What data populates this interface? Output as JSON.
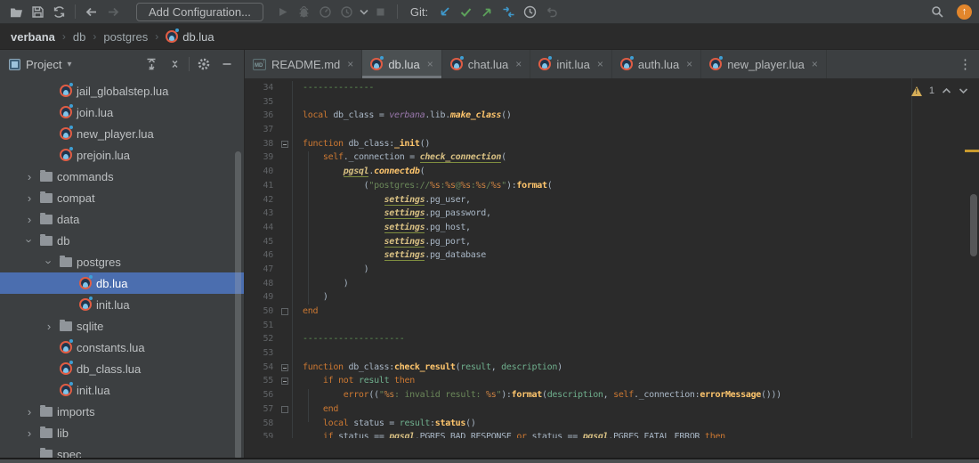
{
  "toolbar": {
    "add_configuration_label": "Add Configuration...",
    "git_label": "Git:",
    "left_icons": [
      "open-project-icon",
      "save-all-icon",
      "synchronize-icon",
      "back-icon",
      "forward-icon"
    ],
    "run_icons": [
      "run-icon",
      "debug-icon",
      "profiler-icon",
      "coverage-icon",
      "dropdown-arrow-icon",
      "stop-icon"
    ],
    "git_icons": [
      "git-update-icon",
      "git-commit-icon",
      "git-push-icon",
      "git-merge-icon",
      "git-history-icon",
      "git-rollback-icon"
    ],
    "right_icons": [
      "search-icon",
      "update-badge"
    ]
  },
  "breadcrumbs": {
    "items": [
      {
        "label": "verbana",
        "bold": true
      },
      {
        "label": "db"
      },
      {
        "label": "postgres"
      },
      {
        "label": "db.lua",
        "icon": "lua"
      }
    ]
  },
  "project_panel": {
    "title": "Project",
    "header_icons": [
      "expand-all-icon",
      "collapse-all-icon",
      "settings-gear-icon",
      "hide-panel-icon"
    ],
    "tree": [
      {
        "label": "jail_globalstep.lua",
        "icon": "lua",
        "level": 2,
        "chevron": "none"
      },
      {
        "label": "join.lua",
        "icon": "lua",
        "level": 2,
        "chevron": "none"
      },
      {
        "label": "new_player.lua",
        "icon": "lua",
        "level": 2,
        "chevron": "none"
      },
      {
        "label": "prejoin.lua",
        "icon": "lua",
        "level": 2,
        "chevron": "none"
      },
      {
        "label": "commands",
        "icon": "folder",
        "level": 1,
        "chevron": "closed"
      },
      {
        "label": "compat",
        "icon": "folder",
        "level": 1,
        "chevron": "closed"
      },
      {
        "label": "data",
        "icon": "folder",
        "level": 1,
        "chevron": "closed"
      },
      {
        "label": "db",
        "icon": "folder",
        "level": 1,
        "chevron": "open"
      },
      {
        "label": "postgres",
        "icon": "folder",
        "level": 2,
        "chevron": "open"
      },
      {
        "label": "db.lua",
        "icon": "lua",
        "level": 3,
        "chevron": "none",
        "selected": true
      },
      {
        "label": "init.lua",
        "icon": "lua",
        "level": 3,
        "chevron": "none"
      },
      {
        "label": "sqlite",
        "icon": "folder",
        "level": 2,
        "chevron": "closed"
      },
      {
        "label": "constants.lua",
        "icon": "lua",
        "level": 2,
        "chevron": "none"
      },
      {
        "label": "db_class.lua",
        "icon": "lua",
        "level": 2,
        "chevron": "none"
      },
      {
        "label": "init.lua",
        "icon": "lua",
        "level": 2,
        "chevron": "none"
      },
      {
        "label": "imports",
        "icon": "folder",
        "level": 1,
        "chevron": "closed"
      },
      {
        "label": "lib",
        "icon": "folder",
        "level": 1,
        "chevron": "closed"
      },
      {
        "label": "spec",
        "icon": "folder",
        "level": 1,
        "chevron": "none"
      }
    ]
  },
  "editor": {
    "tabs": [
      {
        "label": "README.md",
        "icon": "md"
      },
      {
        "label": "db.lua",
        "icon": "lua",
        "active": true
      },
      {
        "label": "chat.lua",
        "icon": "lua"
      },
      {
        "label": "init.lua",
        "icon": "lua"
      },
      {
        "label": "auth.lua",
        "icon": "lua"
      },
      {
        "label": "new_player.lua",
        "icon": "lua"
      }
    ],
    "warning_count": "1",
    "lines": [
      {
        "n": "34",
        "fold": "",
        "segs": [
          [
            "c",
            "--------------"
          ]
        ]
      },
      {
        "n": "35",
        "fold": "",
        "segs": []
      },
      {
        "n": "36",
        "fold": "",
        "segs": [
          [
            "k",
            "local"
          ],
          [
            "t",
            " db_class = "
          ],
          [
            "g",
            "verbana"
          ],
          [
            "t",
            ".lib."
          ],
          [
            "fi",
            "make_class"
          ],
          [
            "t",
            "()"
          ]
        ]
      },
      {
        "n": "37",
        "fold": "",
        "segs": []
      },
      {
        "n": "38",
        "fold": "s",
        "segs": [
          [
            "k",
            "function"
          ],
          [
            "t",
            " db_class:"
          ],
          [
            "f",
            "_init"
          ],
          [
            "t",
            "()"
          ]
        ]
      },
      {
        "n": "39",
        "fold": "",
        "segs": [
          [
            "t",
            "    "
          ],
          [
            "k",
            "self"
          ],
          [
            "t",
            "._connection = "
          ],
          [
            "u",
            "check_connection"
          ],
          [
            "t",
            "("
          ]
        ]
      },
      {
        "n": "40",
        "fold": "",
        "segs": [
          [
            "t",
            "        "
          ],
          [
            "u",
            "pgsql"
          ],
          [
            "t",
            "."
          ],
          [
            "fi",
            "connectdb"
          ],
          [
            "t",
            "("
          ]
        ]
      },
      {
        "n": "41",
        "fold": "",
        "segs": [
          [
            "t",
            "            ("
          ],
          [
            "s",
            "\"postgres://"
          ],
          [
            "e",
            "%s"
          ],
          [
            "s",
            ":"
          ],
          [
            "e",
            "%s"
          ],
          [
            "s",
            "@"
          ],
          [
            "e",
            "%s"
          ],
          [
            "s",
            ":"
          ],
          [
            "e",
            "%s"
          ],
          [
            "s",
            "/"
          ],
          [
            "e",
            "%s"
          ],
          [
            "s",
            "\""
          ],
          [
            "t",
            "):"
          ],
          [
            "f",
            "format"
          ],
          [
            "t",
            "("
          ]
        ]
      },
      {
        "n": "42",
        "fold": "",
        "segs": [
          [
            "t",
            "                "
          ],
          [
            "u",
            "settings"
          ],
          [
            "t",
            ".pg_user,"
          ]
        ]
      },
      {
        "n": "43",
        "fold": "",
        "segs": [
          [
            "t",
            "                "
          ],
          [
            "u",
            "settings"
          ],
          [
            "t",
            ".pg_password,"
          ]
        ]
      },
      {
        "n": "44",
        "fold": "",
        "segs": [
          [
            "t",
            "                "
          ],
          [
            "u",
            "settings"
          ],
          [
            "t",
            ".pg_host,"
          ]
        ]
      },
      {
        "n": "45",
        "fold": "",
        "segs": [
          [
            "t",
            "                "
          ],
          [
            "u",
            "settings"
          ],
          [
            "t",
            ".pg_port,"
          ]
        ]
      },
      {
        "n": "46",
        "fold": "",
        "segs": [
          [
            "t",
            "                "
          ],
          [
            "u",
            "settings"
          ],
          [
            "t",
            ".pg_database"
          ]
        ]
      },
      {
        "n": "47",
        "fold": "",
        "segs": [
          [
            "t",
            "            )"
          ]
        ]
      },
      {
        "n": "48",
        "fold": "",
        "segs": [
          [
            "t",
            "        )"
          ]
        ]
      },
      {
        "n": "49",
        "fold": "",
        "segs": [
          [
            "t",
            "    )"
          ]
        ]
      },
      {
        "n": "50",
        "fold": "e",
        "segs": [
          [
            "k",
            "end"
          ]
        ]
      },
      {
        "n": "51",
        "fold": "",
        "segs": []
      },
      {
        "n": "52",
        "fold": "",
        "segs": [
          [
            "c",
            "--------------------"
          ]
        ]
      },
      {
        "n": "53",
        "fold": "",
        "segs": []
      },
      {
        "n": "54",
        "fold": "s",
        "segs": [
          [
            "k",
            "function"
          ],
          [
            "t",
            " db_class:"
          ],
          [
            "f",
            "check_result"
          ],
          [
            "t",
            "("
          ],
          [
            "p",
            "result"
          ],
          [
            "t",
            ", "
          ],
          [
            "p",
            "description"
          ],
          [
            "t",
            ")"
          ]
        ]
      },
      {
        "n": "55",
        "fold": "s",
        "segs": [
          [
            "t",
            "    "
          ],
          [
            "k",
            "if"
          ],
          [
            "t",
            " "
          ],
          [
            "k",
            "not"
          ],
          [
            "t",
            " "
          ],
          [
            "p",
            "result"
          ],
          [
            "t",
            " "
          ],
          [
            "k",
            "then"
          ]
        ]
      },
      {
        "n": "56",
        "fold": "",
        "segs": [
          [
            "t",
            "        "
          ],
          [
            "k",
            "error"
          ],
          [
            "t",
            "(("
          ],
          [
            "s",
            "\""
          ],
          [
            "e",
            "%s"
          ],
          [
            "s",
            ": invalid result: "
          ],
          [
            "e",
            "%s"
          ],
          [
            "s",
            "\""
          ],
          [
            "t",
            "):"
          ],
          [
            "f",
            "format"
          ],
          [
            "t",
            "("
          ],
          [
            "p",
            "description"
          ],
          [
            "t",
            ", "
          ],
          [
            "k",
            "self"
          ],
          [
            "t",
            "._connection:"
          ],
          [
            "f",
            "errorMessage"
          ],
          [
            "t",
            "()))"
          ]
        ]
      },
      {
        "n": "57",
        "fold": "e",
        "segs": [
          [
            "t",
            "    "
          ],
          [
            "k",
            "end"
          ]
        ]
      },
      {
        "n": "58",
        "fold": "",
        "segs": [
          [
            "t",
            "    "
          ],
          [
            "k",
            "local"
          ],
          [
            "t",
            " status = "
          ],
          [
            "p",
            "result"
          ],
          [
            "t",
            ":"
          ],
          [
            "f",
            "status"
          ],
          [
            "t",
            "()"
          ]
        ]
      },
      {
        "n": "59",
        "fold": "",
        "segs": [
          [
            "t",
            "    "
          ],
          [
            "k",
            "if"
          ],
          [
            "t",
            " status == "
          ],
          [
            "u",
            "pgsql"
          ],
          [
            "t",
            ".PGRES_BAD_RESPONSE "
          ],
          [
            "k",
            "or"
          ],
          [
            "t",
            " status == "
          ],
          [
            "u",
            "pgsql"
          ],
          [
            "t",
            ".PGRES_FATAL_ERROR "
          ],
          [
            "k",
            "then"
          ]
        ]
      }
    ]
  },
  "colors": {
    "selection_blue": "#4b6eaf",
    "warning_yellow": "#d6ae58",
    "update_badge_orange": "#e2862c",
    "git_blue": "#3f99cc",
    "git_green": "#5da25b",
    "active_tab_underline": "#72777c",
    "lua_icon_coral": "#e05d44",
    "lua_icon_blue": "#7fc4ea"
  }
}
